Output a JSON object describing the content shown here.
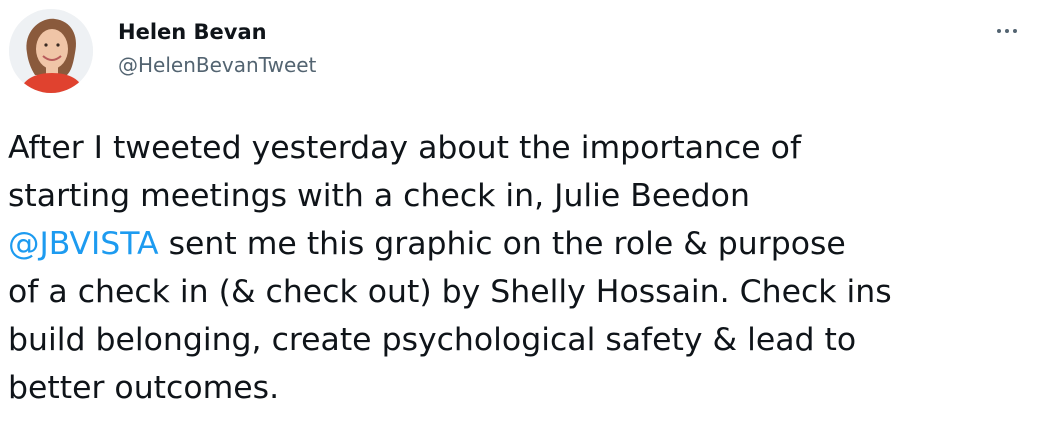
{
  "tweet": {
    "author": {
      "display_name": "Helen Bevan",
      "handle": "@HelenBevanTweet",
      "avatar_icon": "profile-photo-icon"
    },
    "more_icon": "ellipsis-icon",
    "body_segments": {
      "part1": "After I tweeted yesterday about the importance of\nstarting meetings with a check in, Julie Beedon\n",
      "mention": "@JBVISTA",
      "part2": " sent me this graphic on the role & purpose\nof a check in (& check out) by Shelly Hossain. Check ins\nbuild belonging, create psychological safety & lead to\nbetter outcomes."
    },
    "colors": {
      "text": "#0f1419",
      "secondary": "#536471",
      "link": "#1d9bf0"
    }
  }
}
